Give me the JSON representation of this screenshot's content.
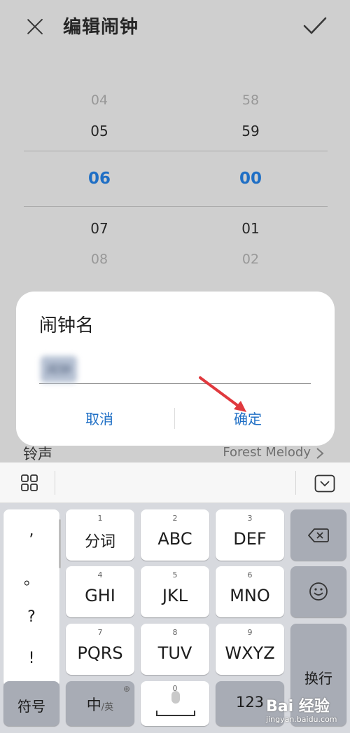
{
  "header": {
    "title": "编辑闹钟"
  },
  "picker": {
    "hours": {
      "far_prev": "04",
      "prev": "05",
      "selected": "06",
      "next": "07",
      "far_next": "08"
    },
    "minutes": {
      "far_prev": "58",
      "prev": "59",
      "selected": "00",
      "next": "01",
      "far_next": "02"
    }
  },
  "ringtone": {
    "label": "铃声",
    "value": "Forest Melody"
  },
  "dialog": {
    "title": "闹钟名",
    "input_value": "闹钟",
    "cancel_label": "取消",
    "confirm_label": "确定"
  },
  "keyboard": {
    "punctuation": [
      ",",
      "。",
      "?",
      "!"
    ],
    "keys": [
      {
        "num": "1",
        "label": "分词"
      },
      {
        "num": "2",
        "label": "ABC"
      },
      {
        "num": "3",
        "label": "DEF"
      },
      {
        "num": "4",
        "label": "GHI"
      },
      {
        "num": "5",
        "label": "JKL"
      },
      {
        "num": "6",
        "label": "MNO"
      },
      {
        "num": "7",
        "label": "PQRS"
      },
      {
        "num": "8",
        "label": "TUV"
      },
      {
        "num": "9",
        "label": "WXYZ"
      }
    ],
    "symbols_label": "符号",
    "lang_label": "中",
    "lang_sub": "/英",
    "space_num": "0",
    "numbers_label": "123",
    "enter_label": "换行"
  },
  "watermark": {
    "main": "Bai 经验",
    "sub": "jingyan.baidu.com"
  },
  "colors": {
    "accent": "#1f6fc5",
    "dim_background": "#cfcfcf",
    "keyboard_bg": "#d7d9de",
    "arrow": "#e0393e"
  }
}
